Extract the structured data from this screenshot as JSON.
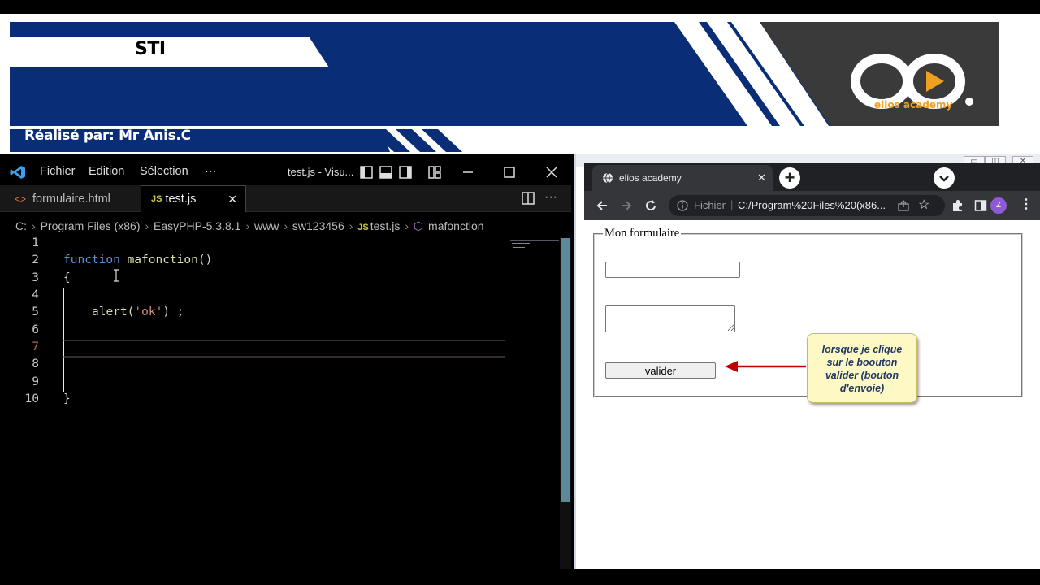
{
  "banner": {
    "title": "STI",
    "author": "Réalisé par: Mr Anis.C",
    "logo_letters": "eo",
    "logo_brand": "elios academy",
    "colors": {
      "navy": "#0a2d78",
      "dark": "#3a3a3a",
      "accent": "#f0a020"
    }
  },
  "vscode": {
    "menu": [
      "Fichier",
      "Edition",
      "Sélection",
      "···"
    ],
    "window_title": "test.js - Visu...",
    "tabs": [
      {
        "label": "formulaire.html",
        "icon": "html-file-icon"
      },
      {
        "label": "test.js",
        "icon": "js-file-icon",
        "close": "✕"
      }
    ],
    "breadcrumb": [
      "C:",
      "Program Files (x86)",
      "EasyPHP-5.3.8.1",
      "www",
      "sw123456",
      "test.js",
      "mafonction"
    ],
    "js_badge": "JS",
    "line_numbers": [
      "1",
      "2",
      "3",
      "4",
      "5",
      "6",
      "7",
      "8",
      "9",
      "10"
    ],
    "code": {
      "line2_keyword": "function",
      "line2_name": "mafonction",
      "line2_parens": "()",
      "line3": "{",
      "line5_call": "alert(",
      "line5_string": "'ok'",
      "line5_end": ") ;",
      "line10": "}"
    },
    "current_line": 7
  },
  "browser": {
    "tab_title": "elios academy",
    "tab_close": "✕",
    "new_tab": "+",
    "address_label": "Fichier",
    "address": "C:/Program%20Files%20(x86...",
    "profile_initial": "Z",
    "page": {
      "legend": "Mon formulaire",
      "button_label": "valider"
    },
    "annotation": "lorsque je clique sur le boouton valider (bouton d'envoie)",
    "annotation_lines": [
      "lorsque je clique",
      "sur le boouton",
      "valider (bouton",
      "d'envoie)"
    ]
  }
}
